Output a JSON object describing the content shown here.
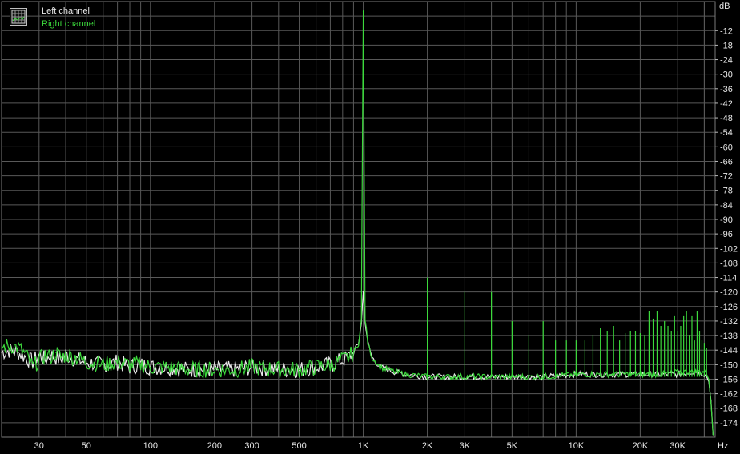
{
  "chart_data": {
    "type": "line",
    "title": "",
    "xlabel": "",
    "ylabel": "",
    "x_scale": "log",
    "x_unit": "Hz",
    "y_unit": "dB",
    "xlim": [
      20,
      45000
    ],
    "ylim": [
      -180,
      0
    ],
    "grid": true,
    "legend": "top-left",
    "x_ticks": [
      {
        "value": 30,
        "label": "30"
      },
      {
        "value": 50,
        "label": "50"
      },
      {
        "value": 100,
        "label": "100"
      },
      {
        "value": 200,
        "label": "200"
      },
      {
        "value": 300,
        "label": "300"
      },
      {
        "value": 500,
        "label": "500"
      },
      {
        "value": 1000,
        "label": "1K"
      },
      {
        "value": 2000,
        "label": "2K"
      },
      {
        "value": 3000,
        "label": "3K"
      },
      {
        "value": 5000,
        "label": "5K"
      },
      {
        "value": 10000,
        "label": "10K"
      },
      {
        "value": 20000,
        "label": "20K"
      },
      {
        "value": 30000,
        "label": "30K"
      }
    ],
    "y_ticks": [
      -12,
      -18,
      -24,
      -30,
      -36,
      -42,
      -48,
      -54,
      -60,
      -66,
      -72,
      -78,
      -84,
      -90,
      -96,
      -102,
      -108,
      -114,
      -120,
      -126,
      -132,
      -138,
      -144,
      -150,
      -156,
      -162,
      -168,
      -174
    ],
    "series": [
      {
        "name": "Left channel",
        "color": "#e8e8e8",
        "x": [
          20,
          22,
          24,
          26,
          28,
          30,
          32,
          34,
          36,
          38,
          40,
          45,
          50,
          60,
          70,
          80,
          90,
          100,
          120,
          150,
          200,
          250,
          300,
          400,
          500,
          600,
          700,
          800,
          850,
          900,
          950,
          980,
          1000,
          1020,
          1050,
          1100,
          1200,
          1400,
          1600,
          2000,
          2500,
          3000,
          4000,
          5000,
          7000,
          10000,
          15000,
          20000,
          25000,
          30000,
          35000,
          38000,
          40000,
          41000,
          42000,
          43000,
          44000
        ],
        "values": [
          -145,
          -144,
          -145,
          -147,
          -149,
          -146,
          -148,
          -146,
          -147,
          -148,
          -146,
          -148,
          -149,
          -150,
          -149,
          -151,
          -150,
          -151,
          -151,
          -152,
          -152,
          -152,
          -151,
          -152,
          -152,
          -151,
          -150,
          -148,
          -147,
          -145,
          -141,
          -133,
          -120,
          -132,
          -141,
          -147,
          -151,
          -153,
          -154,
          -155,
          -155,
          -155,
          -155,
          -155,
          -155,
          -154,
          -154,
          -154,
          -154,
          -154,
          -153,
          -153,
          -154,
          -155,
          -157,
          -165,
          -179
        ]
      },
      {
        "name": "Right channel",
        "color": "#3cd93c",
        "x": [
          20,
          22,
          24,
          26,
          28,
          30,
          32,
          34,
          36,
          38,
          40,
          45,
          50,
          60,
          70,
          80,
          90,
          100,
          120,
          150,
          200,
          250,
          300,
          400,
          500,
          600,
          700,
          800,
          850,
          900,
          950,
          980,
          1000,
          1020,
          1050,
          1100,
          1200,
          1400,
          1600,
          2000,
          2500,
          3000,
          4000,
          5000,
          7000,
          10000,
          15000,
          20000,
          25000,
          30000,
          35000,
          38000,
          40000,
          41000,
          42000,
          43000,
          44000
        ],
        "values": [
          -143,
          -142,
          -143,
          -146,
          -151,
          -148,
          -146,
          -147,
          -145,
          -147,
          -146,
          -147,
          -149,
          -150,
          -149,
          -150,
          -150,
          -151,
          -151,
          -152,
          -152,
          -152,
          -151,
          -152,
          -152,
          -151,
          -150,
          -148,
          -147,
          -145,
          -141,
          -132,
          -4,
          -131,
          -141,
          -147,
          -151,
          -153,
          -154,
          -155,
          -155,
          -155,
          -155,
          -155,
          -155,
          -154,
          -154,
          -154,
          -154,
          -153,
          -153,
          -153,
          -153,
          -154,
          -156,
          -166,
          -179
        ],
        "harmonic_peaks": [
          {
            "x": 2000,
            "y": -114
          },
          {
            "x": 3000,
            "y": -120
          },
          {
            "x": 4000,
            "y": -120
          },
          {
            "x": 5000,
            "y": -132
          },
          {
            "x": 6000,
            "y": -138
          },
          {
            "x": 7000,
            "y": -132
          },
          {
            "x": 8000,
            "y": -140
          },
          {
            "x": 9000,
            "y": -140
          },
          {
            "x": 10000,
            "y": -140
          },
          {
            "x": 11000,
            "y": -140
          },
          {
            "x": 12000,
            "y": -138
          },
          {
            "x": 13000,
            "y": -135
          },
          {
            "x": 14000,
            "y": -136
          },
          {
            "x": 15000,
            "y": -134
          },
          {
            "x": 16000,
            "y": -140
          },
          {
            "x": 17000,
            "y": -137
          },
          {
            "x": 18000,
            "y": -136
          },
          {
            "x": 19000,
            "y": -136
          },
          {
            "x": 20000,
            "y": -137
          },
          {
            "x": 21000,
            "y": -138
          },
          {
            "x": 22000,
            "y": -128
          },
          {
            "x": 23000,
            "y": -131
          },
          {
            "x": 24000,
            "y": -128
          },
          {
            "x": 25000,
            "y": -134
          },
          {
            "x": 26000,
            "y": -132
          },
          {
            "x": 27000,
            "y": -134
          },
          {
            "x": 28000,
            "y": -136
          },
          {
            "x": 29000,
            "y": -130
          },
          {
            "x": 30000,
            "y": -136
          },
          {
            "x": 31000,
            "y": -134
          },
          {
            "x": 32000,
            "y": -130
          },
          {
            "x": 33000,
            "y": -128
          },
          {
            "x": 34000,
            "y": -138
          },
          {
            "x": 35000,
            "y": -130
          },
          {
            "x": 36000,
            "y": -140
          },
          {
            "x": 37000,
            "y": -128
          },
          {
            "x": 38000,
            "y": -136
          },
          {
            "x": 39000,
            "y": -140
          },
          {
            "x": 40000,
            "y": -141
          },
          {
            "x": 41000,
            "y": -143
          }
        ]
      }
    ]
  },
  "legend": {
    "left_label": "Left channel",
    "right_label": "Right channel",
    "icon": "grid-icon"
  },
  "axis_units": {
    "y": "dB",
    "x": "Hz"
  },
  "colors": {
    "background": "#000000",
    "grid": "#595959",
    "text": "#e8e8e8",
    "left": "#e8e8e8",
    "right": "#3cd93c"
  }
}
